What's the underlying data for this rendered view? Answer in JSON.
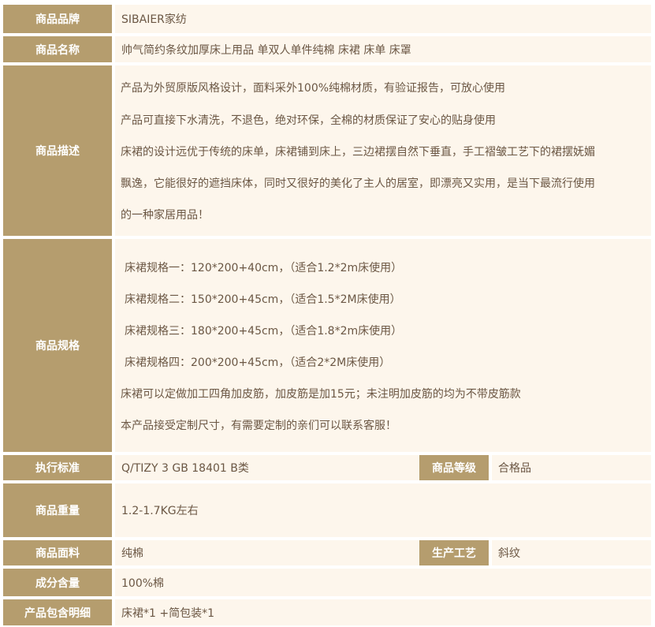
{
  "rows": {
    "brand": {
      "label": "商品品牌",
      "value": "SIBAIER家纺"
    },
    "name": {
      "label": "商品名称",
      "value": "帅气简约条纹加厚床上用品 单双人单件纯棉 床裙 床单 床罩"
    },
    "desc": {
      "label": "商品描述",
      "lines": [
        "产品为外贸原版风格设计，面料采外100%纯棉材质，有验证报告，可放心使用",
        "产品可直接下水清洗，不退色，绝对环保，全棉的材质保证了安心的贴身使用",
        "床裙的设计远优于传统的床单，床裙铺到床上，三边裙摆自然下垂直，手工褶皱工艺下的裙摆妩媚",
        "飘逸，它能很好的遮挡床体，同时又很好的美化了主人的居室，即漂亮又实用，是当下最流行使用",
        "的一种家居用品！"
      ]
    },
    "spec": {
      "label": "商品规格",
      "lines": [
        "床裙规格一：120*200+40cm，（适合1.2*2m床使用）",
        "床裙规格二：150*200+45cm，（适合1.5*2M床使用）",
        "床裙规格三：180*200+45cm，（适合1.8*2m床使用）",
        "床裙规格四：200*200+45cm，（适合2*2M床使用）",
        "床裙可以定做加工四角加皮筋，加皮筋是加15元；未注明加皮筋的均为不带皮筋款",
        "本产品接受定制尺寸，有需要定制的亲们可以联系客服！"
      ]
    },
    "standard": {
      "label": "执行标准",
      "value": "Q/TIZY 3 GB 18401 B类",
      "label2": "商品等级",
      "value2": "合格品"
    },
    "weight": {
      "label": "商品重量",
      "value": "1.2-1.7KG左右"
    },
    "fabric": {
      "label": "商品面料",
      "value": "纯棉",
      "label2": "生产工艺",
      "value2": "斜纹"
    },
    "content": {
      "label": "成分含量",
      "value": "100%棉"
    },
    "package": {
      "label": "产品包含明细",
      "value": "床裙*1 +简包装*1"
    }
  },
  "colors": {
    "label_bg": "#b59d6e",
    "value_bg": "#fdf6ec",
    "text": "#6b5744"
  }
}
